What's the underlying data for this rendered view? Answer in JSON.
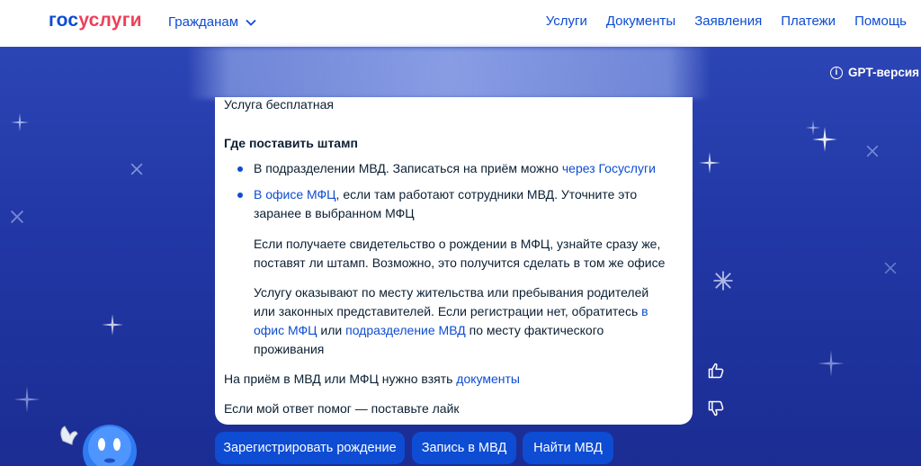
{
  "header": {
    "logo_part1": "гос",
    "logo_part2": "услуги",
    "citizens_label": "Гражданам",
    "nav": [
      "Услуги",
      "Документы",
      "Заявления",
      "Платежи",
      "Помощь"
    ]
  },
  "gpt_badge": {
    "icon": "info-icon",
    "label": "GPT-версия"
  },
  "answer": {
    "free_service": "Услуга бесплатная",
    "where_heading": "Где поставить штамп",
    "bullet1_text": "В подразделении МВД. Записаться на приём можно ",
    "bullet1_link": "через Госуслуги",
    "bullet2_link": "В офисе МФЦ",
    "bullet2_text_line1": ", если там работают сотрудники МВД. Уточните это",
    "bullet2_text_line2": "заранее в выбранном МФЦ",
    "para1_line1": "Если получаете свидетельство о рождении в МФЦ, узнайте сразу же,",
    "para1_line2": "поставят ли штамп. Возможно, это получится сделать в том же офисе",
    "para2_line1": "Услугу оказывают по месту жительства или пребывания родителей",
    "para2_line2a": "или законных представителей. Если регистрации нет, обратитесь ",
    "para2_line2_link": "в",
    "para2_line3_link": "офис МФЦ",
    "para2_line3_mid": " или ",
    "para2_line3_link2": "подразделение МВД",
    "para2_line3_end": " по месту фактического",
    "para2_line4": "проживания",
    "docs_text": "На приём в МВД или МФЦ нужно взять ",
    "docs_link": "документы",
    "like_prompt": "Если мой ответ помог — поставьте лайк"
  },
  "feedback": {
    "like_icon": "thumbs-up-icon",
    "dislike_icon": "thumbs-down-icon"
  },
  "buttons": [
    "Зарегистрировать рождение",
    "Запись в МВД",
    "Найти МВД"
  ],
  "colors": {
    "brand_blue": "#0d4cd3",
    "brand_red": "#ee3f58",
    "sky": "#2238a6"
  }
}
